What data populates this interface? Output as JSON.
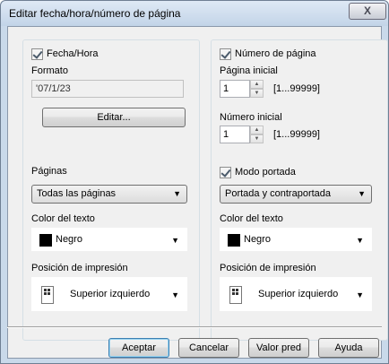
{
  "window": {
    "title": "Editar fecha/hora/número de página",
    "close_glyph": "X"
  },
  "left": {
    "fecha_hora_label": "Fecha/Hora",
    "fecha_hora_checked": true,
    "formato_label": "Formato",
    "formato_value": "'07/1/23",
    "editar_label": "Editar...",
    "paginas_label": "Páginas",
    "paginas_value": "Todas las páginas",
    "color_label": "Color del texto",
    "color_value": "Negro",
    "color_hex": "#000000",
    "posicion_label": "Posición de impresión",
    "posicion_value": "Superior izquierdo"
  },
  "right": {
    "numero_pagina_label": "Número de página",
    "numero_pagina_checked": true,
    "pagina_inicial_label": "Página inicial",
    "pagina_inicial_value": "1",
    "pagina_inicial_range": "[1...99999]",
    "numero_inicial_label": "Número inicial",
    "numero_inicial_value": "1",
    "numero_inicial_range": "[1...99999]",
    "modo_portada_label": "Modo portada",
    "modo_portada_checked": true,
    "portada_value": "Portada y contraportada",
    "color_label": "Color del texto",
    "color_value": "Negro",
    "color_hex": "#000000",
    "posicion_label": "Posición de impresión",
    "posicion_value": "Superior izquierdo"
  },
  "footer": {
    "aceptar": "Aceptar",
    "cancelar": "Cancelar",
    "valor_pred": "Valor pred",
    "ayuda": "Ayuda"
  },
  "icons": {
    "dropdown": "▼",
    "spin_up": "▲",
    "spin_down": "▼"
  }
}
